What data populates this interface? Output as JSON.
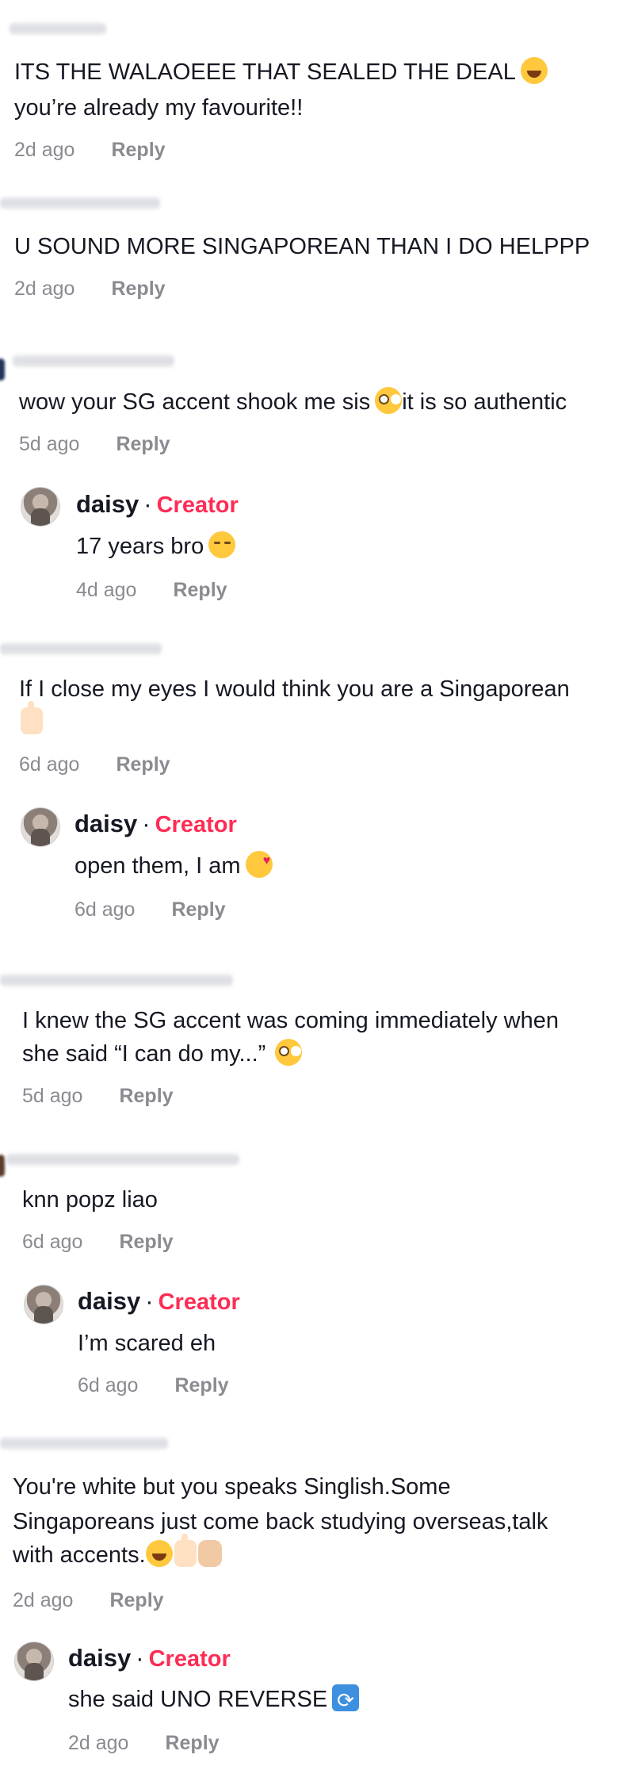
{
  "comments": [
    {
      "text_lines": [
        "ITS THE WALAOEEE THAT SEALED THE DEAL",
        "you’re already my favourite!!"
      ],
      "emoji": "face-with-tears-of-joy",
      "time": "2d ago",
      "reply_label": "Reply"
    },
    {
      "text_lines": [
        "U SOUND MORE SINGAPOREAN THAN I DO HELPPP"
      ],
      "time": "2d ago",
      "reply_label": "Reply"
    },
    {
      "text_lines": [
        "wow your SG accent shook me sis",
        "it is so authentic"
      ],
      "emoji": "flushed-face",
      "time": "5d ago",
      "reply_label": "Reply",
      "creator_reply": {
        "name": "daisy",
        "separator": "·",
        "badge": "Creator",
        "text": "17 years bro",
        "emoji": "relieved-face",
        "time": "4d ago",
        "reply_label": "Reply"
      }
    },
    {
      "text_lines": [
        "If I close my eyes I would think you are a Singaporean"
      ],
      "emoji": "thumbs-up",
      "time": "6d ago",
      "reply_label": "Reply",
      "creator_reply": {
        "name": "daisy",
        "separator": "·",
        "badge": "Creator",
        "text": "open them, I am",
        "emoji": "smiling-face-with-hearts",
        "time": "6d ago",
        "reply_label": "Reply"
      }
    },
    {
      "text_lines": [
        "I knew the SG accent was coming immediately when",
        "she said “I can do my...”"
      ],
      "emoji": "flushed-face",
      "time": "5d ago",
      "reply_label": "Reply"
    },
    {
      "text_lines": [
        "knn popz liao"
      ],
      "time": "6d ago",
      "reply_label": "Reply",
      "creator_reply": {
        "name": "daisy",
        "separator": "·",
        "badge": "Creator",
        "text": "I’m scared eh",
        "time": "6d ago",
        "reply_label": "Reply"
      }
    },
    {
      "text_lines": [
        "You're white but you speaks Singlish.Some",
        "Singaporeans just come back studying overseas,talk",
        "with accents."
      ],
      "emoji": "laugh-thumbs-clap",
      "time": "2d ago",
      "reply_label": "Reply",
      "creator_reply": {
        "name": "daisy",
        "separator": "·",
        "badge": "Creator",
        "text": "she said UNO REVERSE",
        "emoji": "counterclockwise-arrows",
        "time": "2d ago",
        "reply_label": "Reply"
      }
    }
  ],
  "colors": {
    "text": "#161823",
    "meta": "#8a8b91",
    "creator_badge": "#fe2c55"
  }
}
